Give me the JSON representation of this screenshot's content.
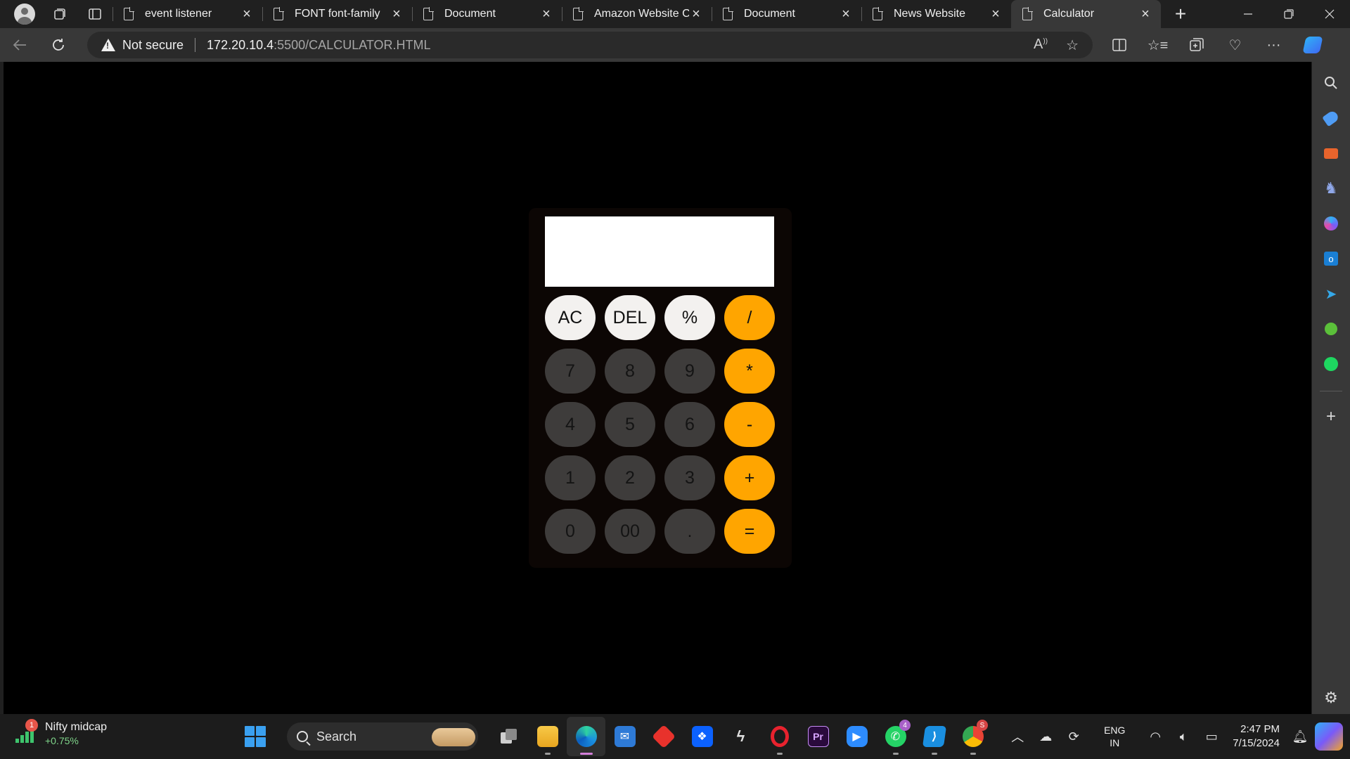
{
  "browser": {
    "tabs": [
      {
        "title": "event listener"
      },
      {
        "title": "FONT font-family"
      },
      {
        "title": "Document"
      },
      {
        "title": "Amazon Website Cl"
      },
      {
        "title": "Document"
      },
      {
        "title": "News Website"
      },
      {
        "title": "Calculator"
      }
    ],
    "active_tab": 6,
    "security_text": "Not secure",
    "url_host": "172.20.10.4",
    "url_path": ":5500/CALCULATOR.HTML"
  },
  "calculator": {
    "display_value": "",
    "keys": [
      {
        "label": "AC",
        "kind": "fn"
      },
      {
        "label": "DEL",
        "kind": "fn"
      },
      {
        "label": "%",
        "kind": "fn"
      },
      {
        "label": "/",
        "kind": "op"
      },
      {
        "label": "7",
        "kind": "num"
      },
      {
        "label": "8",
        "kind": "num"
      },
      {
        "label": "9",
        "kind": "num"
      },
      {
        "label": "*",
        "kind": "op"
      },
      {
        "label": "4",
        "kind": "num"
      },
      {
        "label": "5",
        "kind": "num"
      },
      {
        "label": "6",
        "kind": "num"
      },
      {
        "label": "-",
        "kind": "op"
      },
      {
        "label": "1",
        "kind": "num"
      },
      {
        "label": "2",
        "kind": "num"
      },
      {
        "label": "3",
        "kind": "num"
      },
      {
        "label": "+",
        "kind": "op"
      },
      {
        "label": "0",
        "kind": "num"
      },
      {
        "label": "00",
        "kind": "num"
      },
      {
        "label": ".",
        "kind": "num"
      },
      {
        "label": "=",
        "kind": "op"
      }
    ],
    "colors": {
      "operator": "#ffa500",
      "function": "#f3f1ef",
      "number": "#3e3c3b",
      "body": "#0c0604"
    }
  },
  "taskbar": {
    "widget": {
      "title": "Nifty midcap",
      "change": "+0.75%",
      "badge": "1"
    },
    "search_placeholder": "Search",
    "whatsapp_badge": "4",
    "chrome_badge": "S",
    "language": "ENG",
    "region": "IN",
    "time": "2:47 PM",
    "date": "7/15/2024"
  }
}
